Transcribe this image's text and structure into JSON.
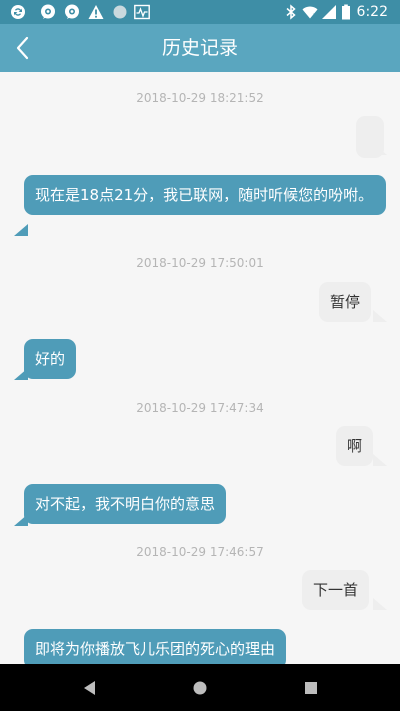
{
  "status_bar": {
    "time": "6:22",
    "icons": [
      "sync-icon",
      "chat-icon",
      "chat-icon",
      "warning-icon",
      "circle-icon",
      "activity-icon",
      "bluetooth-icon",
      "wifi-icon",
      "signal-icon",
      "battery-icon"
    ]
  },
  "app_bar": {
    "title": "历史记录",
    "back_icon": "chevron-left-icon"
  },
  "messages": [
    {
      "timestamp": "2018-10-29 18:21:52",
      "outgoing_text": "",
      "incoming_text": "现在是18点21分，我已联网，随时听候您的吩咐。"
    },
    {
      "timestamp": "2018-10-29 17:50:01",
      "outgoing_text": "暂停",
      "incoming_text": "好的"
    },
    {
      "timestamp": "2018-10-29 17:47:34",
      "outgoing_text": "啊",
      "incoming_text": "对不起，我不明白你的意思"
    },
    {
      "timestamp": "2018-10-29 17:46:57",
      "outgoing_text": "下一首",
      "incoming_text": "即将为你播放飞儿乐团的死心的理由"
    }
  ],
  "nav_bar": {
    "buttons": [
      "back-triangle-icon",
      "home-circle-icon",
      "recents-square-icon"
    ]
  },
  "colors": {
    "status_bar": "#3e8ea6",
    "app_bar": "#5aa6bf",
    "incoming_bubble": "#4f9cb8",
    "outgoing_bubble": "#eeeeee",
    "background": "#f6f6f6"
  }
}
